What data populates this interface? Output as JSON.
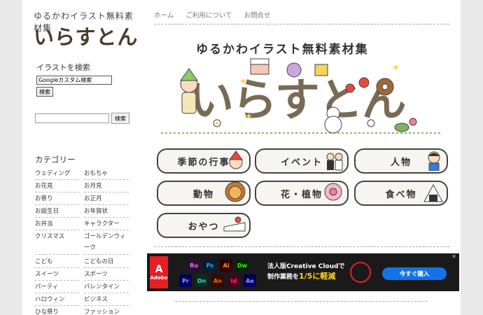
{
  "site": {
    "tagline": "ゆるかわイラスト無料素材集",
    "logo": "いらすとん"
  },
  "sidebar": {
    "search_heading": "イラストを検索",
    "google_placeholder": "Googleカスタム検索",
    "google_button": "検索",
    "site_search_button": "検索",
    "category_heading": "カテゴリー",
    "categories": [
      [
        "ウェディング",
        "おもちゃ"
      ],
      [
        "お花見",
        "お月見"
      ],
      [
        "お祭り",
        "お正月"
      ],
      [
        "お誕生日",
        "お年賀状"
      ],
      [
        "お弁当",
        "キャラクター"
      ],
      [
        "クリスマス",
        "ゴールデンウィーク"
      ],
      [
        "こども",
        "こどもの日"
      ],
      [
        "スイーツ",
        "スポーツ"
      ],
      [
        "パーティ",
        "バレンタイン"
      ],
      [
        "ハロウィン",
        "ビジネス"
      ],
      [
        "ひな祭り",
        "ファッション"
      ]
    ]
  },
  "nav": [
    "ホーム",
    "ご利用について",
    "お問合せ"
  ],
  "hero": {
    "tagline": "ゆるかわイラスト無料素材集",
    "logo": "いらすとん"
  },
  "category_buttons": [
    "季節の行事",
    "イベント",
    "人物",
    "動物",
    "花・植物",
    "食べ物",
    "おやつ"
  ],
  "ad": {
    "brand": "Adobe",
    "apps": [
      "Ru",
      "Ps",
      "Ai",
      "Dw",
      "Pr",
      "Dn",
      "An",
      "Id",
      "Ae"
    ],
    "line1": "法人版Creative Cloudで",
    "line2_a": "制作業務を",
    "line2_b": "1/5に軽減",
    "cta": "今すぐ購入",
    "close": "✕"
  },
  "colors": {
    "ps": "#31a8ff",
    "ai": "#ff9a00",
    "dw": "#35fa00",
    "pr": "#9999ff",
    "ae": "#9999ff",
    "an": "#ff6c00",
    "id": "#ff3366",
    "ru": "#ea77ff",
    "dn": "#4bd9a8"
  }
}
